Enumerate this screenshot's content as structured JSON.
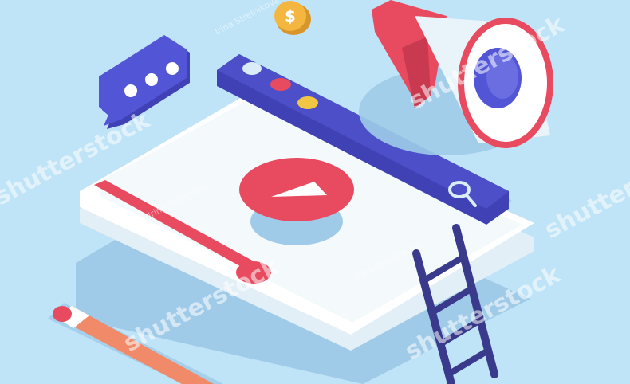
{
  "illustration": {
    "colors": {
      "background": "#bfe3f7",
      "shadow": "#9fcbe8",
      "player_panel": "#ffffff",
      "toolbar": "#4d4fc9",
      "accent_red": "#e84a5f",
      "accent_yellow": "#f2c643",
      "ladder": "#3a3a8c",
      "pencil": "#f08a68",
      "speech_bubble": "#5256d6",
      "coin": "#f4b63f"
    },
    "icons": [
      "speech-bubble-icon",
      "coin-icon",
      "megaphone-icon",
      "play-icon",
      "search-icon",
      "ladder-icon",
      "pencil-icon"
    ],
    "progress": 0.62
  },
  "watermark": {
    "brand": "shutterstock",
    "author": "Irina Strelnikova"
  }
}
